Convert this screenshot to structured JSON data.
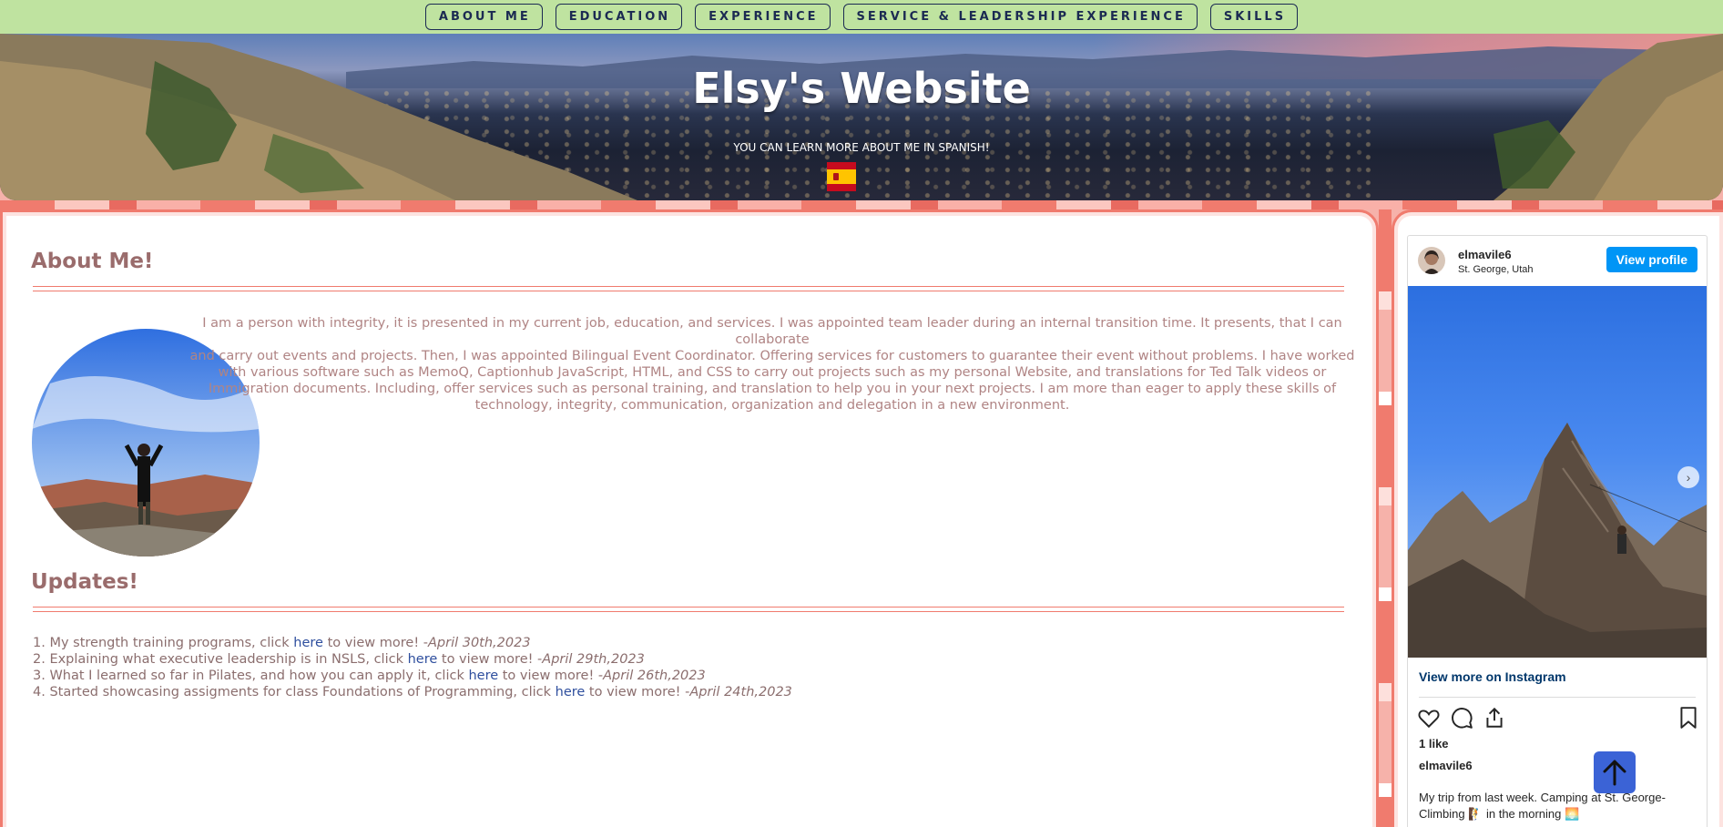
{
  "nav": {
    "items": [
      {
        "label": "ABOUT ME"
      },
      {
        "label": "EDUCATION"
      },
      {
        "label": "EXPERIENCE"
      },
      {
        "label": "SERVICE & LEADERSHIP EXPERIENCE"
      },
      {
        "label": "SKILLS"
      }
    ]
  },
  "hero": {
    "title": "Elsy's Website",
    "subtitle": "YOU CAN LEARN MORE ABOUT ME IN SPANISH!",
    "flags": [
      {
        "icon": "uk-flag-icon"
      },
      {
        "icon": "spain-flag-icon"
      }
    ]
  },
  "about": {
    "heading": "About Me!",
    "lines": [
      "I am a person with integrity, it is presented in my current job, education, and services. I was appointed team leader during an internal transition time. It presents, that I can collaborate",
      "and carry out events and projects. Then, I was appointed Bilingual Event Coordinator. Offering services for customers to guarantee their event without problems. I have worked",
      "with various software such as MemoQ, Captionhub JavaScript, HTML, and CSS to carry out projects such as my personal Website, and translations for Ted Talk videos or",
      "Immigration documents. Including, offer services such as personal training, and translation to help you in your next projects. I am more than eager to apply these skills of",
      "technology, integrity, communication, organization and delegation in a new environment."
    ]
  },
  "updates": {
    "heading": "Updates!",
    "items": [
      {
        "prefix": "1. My strength training programs, click ",
        "link": "here",
        "suffix": " to view more! -",
        "date": "April 30th,2023"
      },
      {
        "prefix": "2. Explaining what executive leadership is in NSLS, click ",
        "link": "here",
        "suffix": " to view more! -",
        "date": "April 29th,2023"
      },
      {
        "prefix": "3. What I learned so far in Pilates, and how you can apply it, click ",
        "link": "here",
        "suffix": " to view more! -",
        "date": "April 26th,2023"
      },
      {
        "prefix": "4. Started showcasing assigments for class Foundations of Programming, click ",
        "link": "here",
        "suffix": " to view more! -",
        "date": "April 24th,2023"
      }
    ]
  },
  "instagram": {
    "username": "elmavile6",
    "location": "St. George, Utah",
    "view_profile": "View profile",
    "view_more": "View more on Instagram",
    "likes": "1 like",
    "caption_user": "elmavile6",
    "caption": "My trip from last week. Camping at St. George- Climbing 🧗 in the morning 🌅",
    "colors": {
      "button": "#0095f6",
      "link": "#00376b"
    }
  },
  "colors": {
    "nav_bg": "#bfe3a0",
    "nav_text": "#1b2a52",
    "accent": "#f07b6e",
    "heading": "#9a6c6c",
    "body_text": "#b08484",
    "link": "#2f4f9e",
    "to_top": "#3b63d6"
  }
}
